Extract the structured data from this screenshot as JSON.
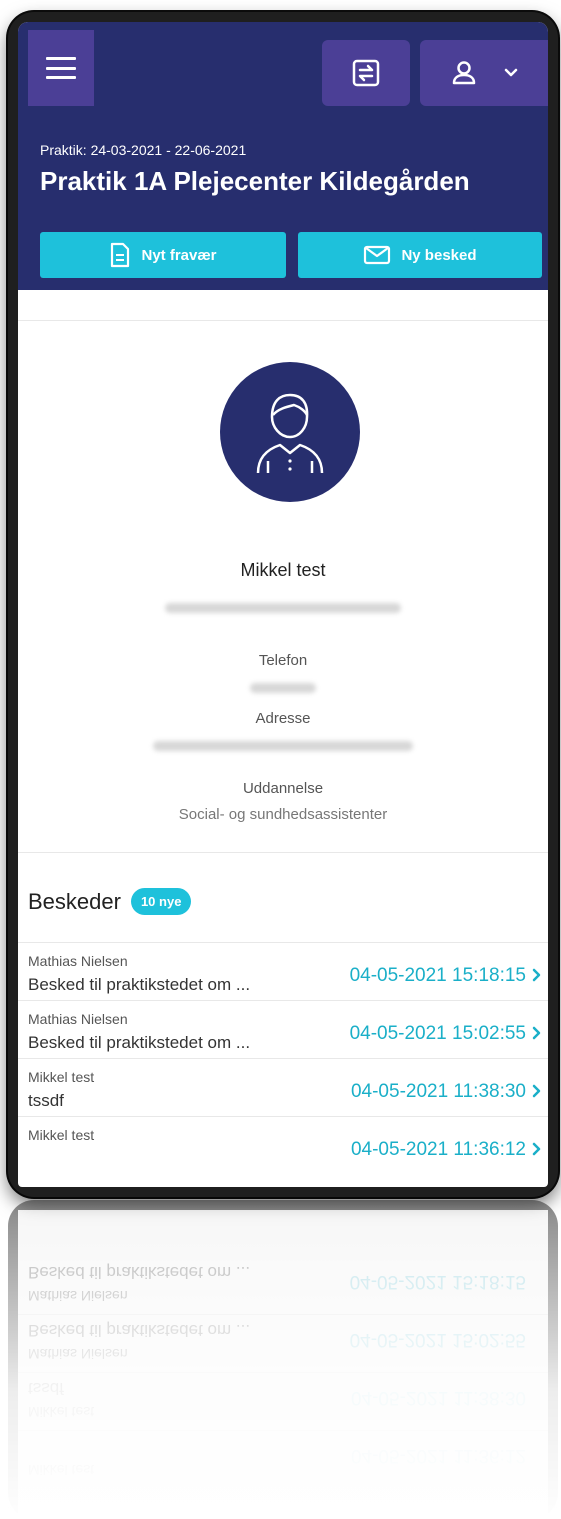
{
  "header": {
    "period": "Praktik: 24-03-2021 - 22-06-2021",
    "title": "Praktik 1A Plejecenter Kildegården",
    "new_absence_label": "Nyt fravær",
    "new_message_label": "Ny besked"
  },
  "profile": {
    "name": "Mikkel test",
    "phone_label": "Telefon",
    "address_label": "Adresse",
    "education_label": "Uddannelse",
    "education_value": "Social- og sundhedsassistenter"
  },
  "messages": {
    "title": "Beskeder",
    "badge": "10 nye",
    "items": [
      {
        "sender": "Mathias Nielsen",
        "subject": "Besked til praktikstedet om ...",
        "date": "04-05-2021 15:18:15"
      },
      {
        "sender": "Mathias Nielsen",
        "subject": "Besked til praktikstedet om ...",
        "date": "04-05-2021 15:02:55"
      },
      {
        "sender": "Mikkel test",
        "subject": "tssdf",
        "date": "04-05-2021 11:38:30"
      },
      {
        "sender": "Mikkel test",
        "subject": "",
        "date": "04-05-2021 11:36:12"
      }
    ]
  },
  "colors": {
    "header_bg": "#272e6e",
    "header_button_bg": "#4b3f96",
    "accent": "#1ec1db",
    "date_text": "#1aafc8"
  },
  "icons": [
    "menu-icon",
    "swap-icon",
    "user-icon",
    "chevron-down-icon",
    "document-icon",
    "envelope-icon",
    "avatar-person-icon",
    "chevron-right-icon"
  ]
}
